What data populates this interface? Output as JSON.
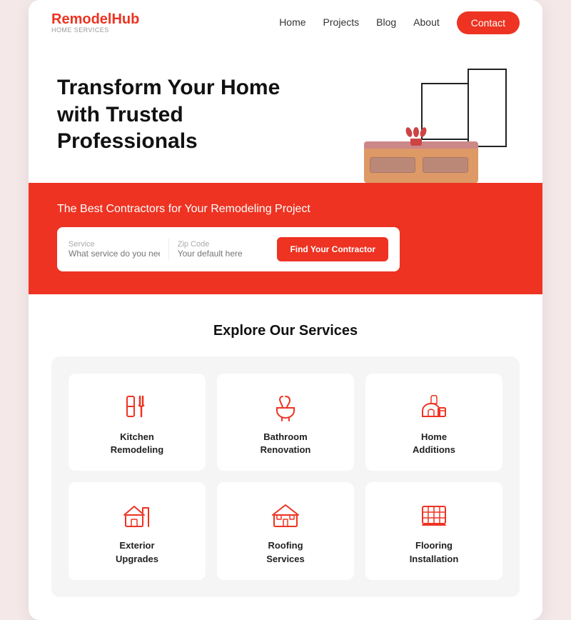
{
  "brand": {
    "name_part1": "Remodel",
    "name_part2": "Hub",
    "tagline": "HOME SERVICES"
  },
  "nav": {
    "links": [
      "Home",
      "Projects",
      "Blog",
      "About"
    ],
    "contact_label": "Contact"
  },
  "hero": {
    "title": "Transform Your Home with Trusted Professionals",
    "band_subtitle": "The Best Contractors for Your Remodeling Project",
    "service_label": "Service",
    "service_placeholder": "What service do you need?",
    "zip_label": "Zip Code",
    "zip_placeholder": "Your default here",
    "cta_label": "Find Your Contractor"
  },
  "services": {
    "section_title": "Explore Our Services",
    "items": [
      {
        "id": "kitchen",
        "name": "Kitchen\nRemodeling"
      },
      {
        "id": "bathroom",
        "name": "Bathroom\nRenovation"
      },
      {
        "id": "home",
        "name": "Home\nAdditions"
      },
      {
        "id": "exterior",
        "name": "Exterior\nUpgrades"
      },
      {
        "id": "roofing",
        "name": "Roofing\nServices"
      },
      {
        "id": "flooring",
        "name": "Flooring\nInstallation"
      }
    ]
  },
  "colors": {
    "accent": "#e03020",
    "accent_hover": "#cc2010"
  }
}
